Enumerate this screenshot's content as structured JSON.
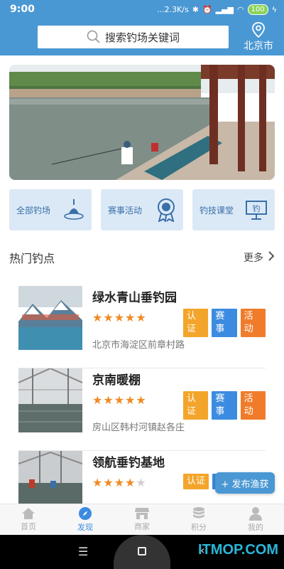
{
  "status": {
    "time": "9:00",
    "network": "...2.3K/s",
    "battery": "100"
  },
  "search": {
    "placeholder": "搜索钓场关键词"
  },
  "city": {
    "name": "北京市"
  },
  "categories": [
    {
      "label": "全部钓场",
      "icon": "float-icon"
    },
    {
      "label": "赛事活动",
      "icon": "medal-icon"
    },
    {
      "label": "钓技课堂",
      "icon": "classroom-board-icon",
      "badge": "钓"
    }
  ],
  "hot": {
    "title": "热门钓点",
    "more": "更多"
  },
  "spots": [
    {
      "name": "绿水青山垂钓园",
      "rating": 5,
      "tags": [
        "认证",
        "赛事",
        "活动"
      ],
      "address": "北京市海淀区前章村路"
    },
    {
      "name": "京南暖棚",
      "rating": 5,
      "tags": [
        "认证",
        "赛事",
        "活动"
      ],
      "address": "房山区韩村河镇赵各庄"
    },
    {
      "name": "领航垂钓基地",
      "rating": 4,
      "tags": [
        "认证",
        "赛"
      ],
      "address": ""
    }
  ],
  "publish_button": "+ 发布渔获",
  "tabs": [
    {
      "label": "首页",
      "icon": "home-icon",
      "active": false
    },
    {
      "label": "发现",
      "icon": "compass-icon",
      "active": true
    },
    {
      "label": "商家",
      "icon": "shop-icon",
      "active": false
    },
    {
      "label": "积分",
      "icon": "coins-icon",
      "active": false
    },
    {
      "label": "我的",
      "icon": "user-icon",
      "active": false
    }
  ],
  "watermark": "ITMOP.COM",
  "colors": {
    "primary": "#4a98d3",
    "active_tab": "#3c8be0",
    "star": "#f08a24",
    "tag_cert": "#f3a52b",
    "tag_match": "#3c8be0",
    "tag_event": "#f07c2b"
  }
}
